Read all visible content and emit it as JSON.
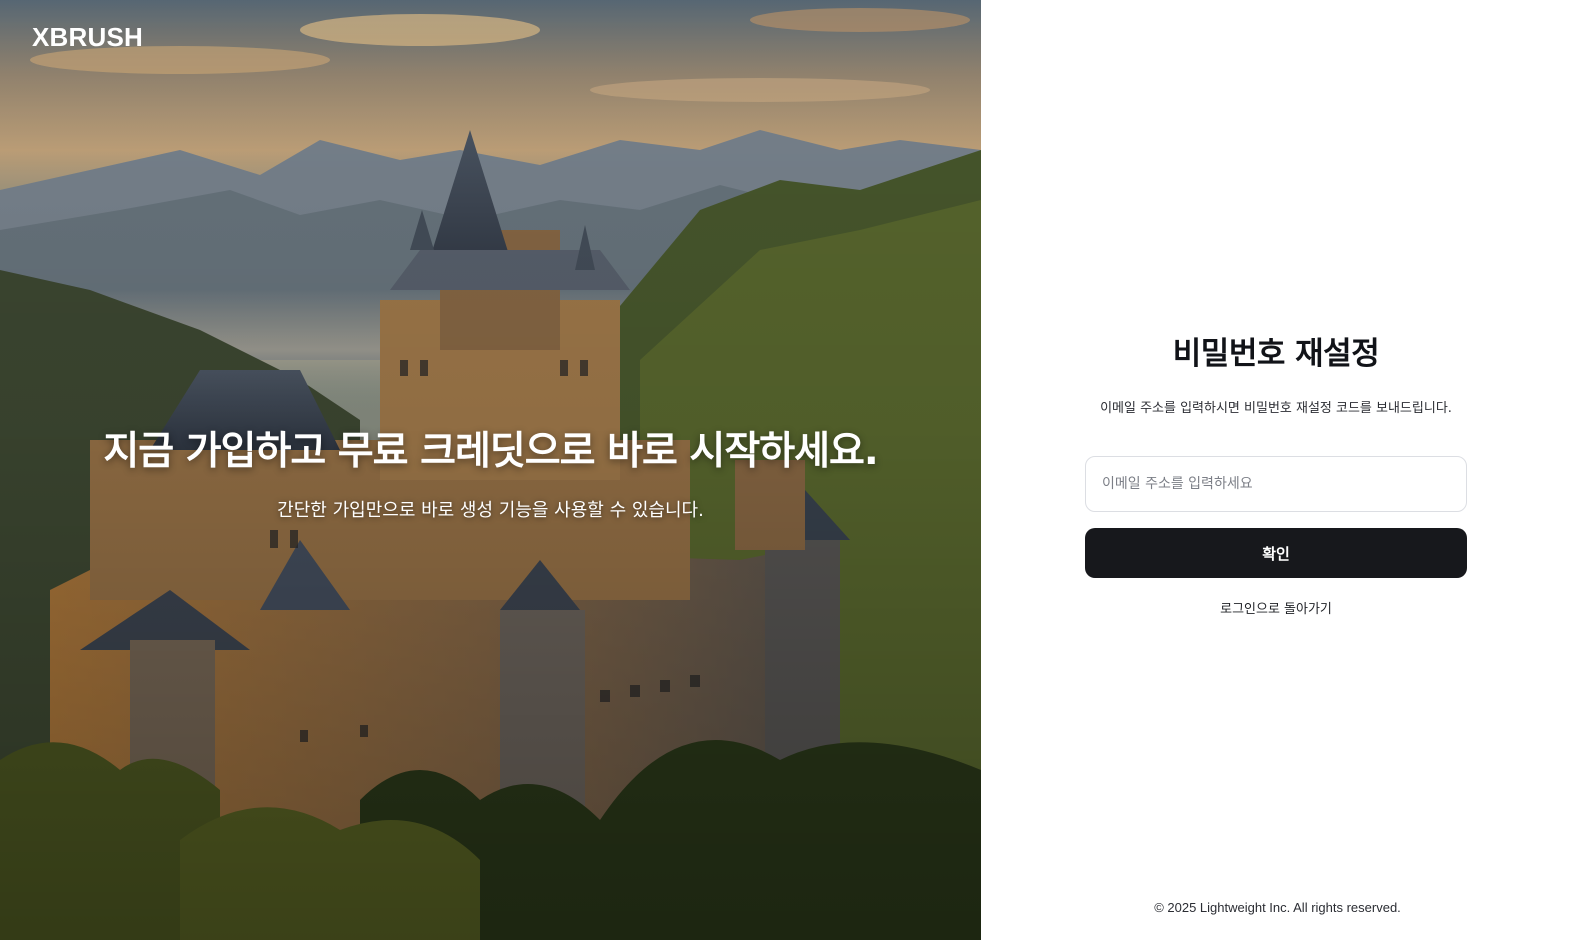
{
  "hero": {
    "brand": "XBRUSH",
    "title": "지금 가입하고 무료 크레딧으로 바로 시작하세요.",
    "subtitle": "간단한 가입만으로 바로 생성 기능을 사용할 수 있습니다."
  },
  "reset_form": {
    "title": "비밀번호 재설정",
    "description": "이메일 주소를 입력하시면 비밀번호 재설정 코드를 보내드립니다.",
    "email_placeholder": "이메일 주소를 입력하세요",
    "email_value": "",
    "confirm_label": "확인",
    "back_to_login_label": "로그인으로 돌아가기"
  },
  "footer": {
    "copyright": "© 2025 Lightweight Inc. All rights reserved."
  },
  "colors": {
    "primary_button": "#17181c",
    "input_border": "#dcdee3",
    "panel_background": "#ffffff",
    "hero_text": "#ffffff"
  }
}
